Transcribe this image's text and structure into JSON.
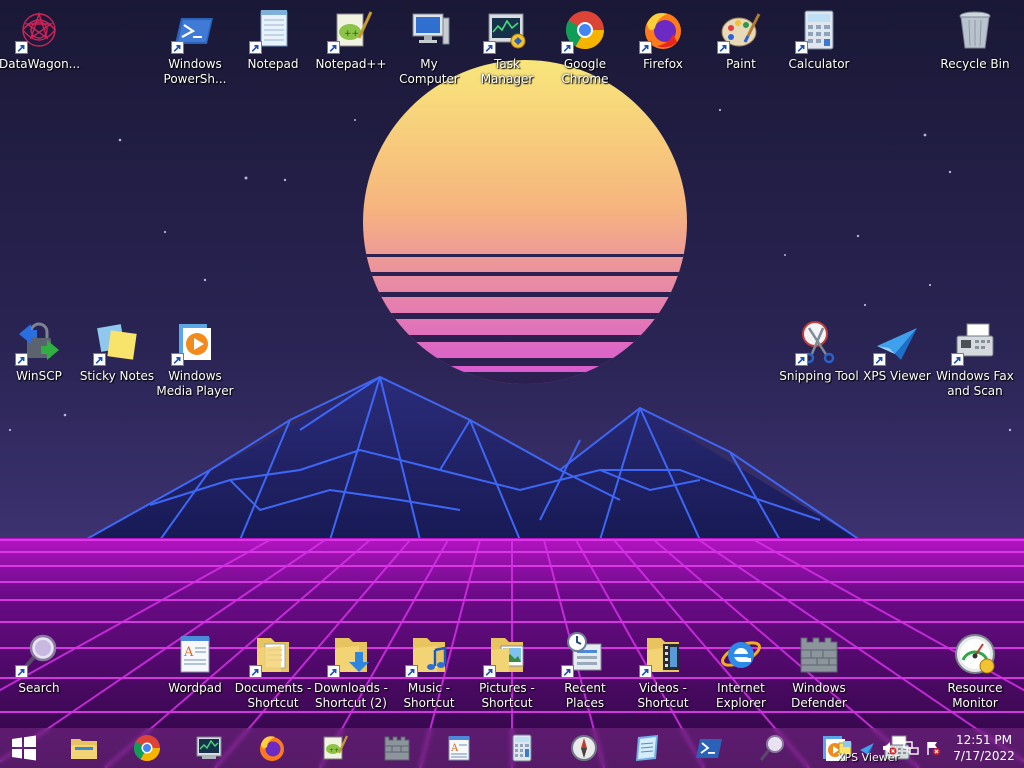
{
  "desktop": {
    "top_row": [
      {
        "name": "datawagon-icon",
        "label": "DataWagon...",
        "icon": "spiral-mandala"
      },
      {
        "name": "windows-powershell-icon",
        "label": "Windows\nPowerSh...",
        "icon": "powershell"
      },
      {
        "name": "notepad-icon",
        "label": "Notepad",
        "icon": "notepad"
      },
      {
        "name": "notepad-plus-plus-icon",
        "label": "Notepad++",
        "icon": "notepad-plus-plus"
      },
      {
        "name": "my-computer-icon",
        "label": "My Computer",
        "icon": "computer"
      },
      {
        "name": "task-manager-icon",
        "label": "Task Manager",
        "icon": "task-manager"
      },
      {
        "name": "google-chrome-icon",
        "label": "Google\nChrome",
        "icon": "chrome"
      },
      {
        "name": "firefox-icon",
        "label": "Firefox",
        "icon": "firefox"
      },
      {
        "name": "paint-icon",
        "label": "Paint",
        "icon": "paint-palette"
      },
      {
        "name": "calculator-icon",
        "label": "Calculator",
        "icon": "calculator"
      },
      {
        "name": "recycle-bin-icon",
        "label": "Recycle Bin",
        "icon": "recycle-bin"
      }
    ],
    "mid_left": [
      {
        "name": "winscp-icon",
        "label": "WinSCP",
        "icon": "winscp-lock"
      },
      {
        "name": "sticky-notes-icon",
        "label": "Sticky Notes",
        "icon": "sticky-notes"
      },
      {
        "name": "windows-media-player-icon",
        "label": "Windows\nMedia Player",
        "icon": "media-player"
      }
    ],
    "mid_right": [
      {
        "name": "snipping-tool-icon",
        "label": "Snipping Tool",
        "icon": "scissors"
      },
      {
        "name": "xps-viewer-icon",
        "label": "XPS Viewer",
        "icon": "paper-plane"
      },
      {
        "name": "windows-fax-and-scan-icon",
        "label": "Windows Fax\nand Scan",
        "icon": "fax-machine"
      }
    ],
    "bottom_row": [
      {
        "name": "search-icon",
        "label": "Search",
        "icon": "magnifier"
      },
      {
        "name": "wordpad-icon",
        "label": "Wordpad",
        "icon": "wordpad"
      },
      {
        "name": "documents-shortcut-icon",
        "label": "Documents -\nShortcut",
        "icon": "folder-documents"
      },
      {
        "name": "downloads-shortcut-icon",
        "label": "Downloads -\nShortcut (2)",
        "icon": "folder-downloads"
      },
      {
        "name": "music-shortcut-icon",
        "label": "Music -\nShortcut",
        "icon": "folder-music"
      },
      {
        "name": "pictures-shortcut-icon",
        "label": "Pictures -\nShortcut",
        "icon": "folder-pictures"
      },
      {
        "name": "recent-places-icon",
        "label": "Recent Places",
        "icon": "recent-places"
      },
      {
        "name": "videos-shortcut-icon",
        "label": "Videos -\nShortcut",
        "icon": "folder-videos"
      },
      {
        "name": "internet-explorer-icon",
        "label": "Internet\nExplorer",
        "icon": "internet-explorer"
      },
      {
        "name": "windows-defender-icon",
        "label": "Windows\nDefender",
        "icon": "castle-wall"
      },
      {
        "name": "resource-monitor-icon",
        "label": "Resource\nMonitor",
        "icon": "gauge"
      }
    ]
  },
  "taskbar": {
    "buttons": [
      {
        "name": "start-button",
        "icon": "windows-logo"
      },
      {
        "name": "taskbar-file-explorer",
        "icon": "file-explorer"
      },
      {
        "name": "taskbar-chrome",
        "icon": "chrome"
      },
      {
        "name": "taskbar-task-manager",
        "icon": "task-manager"
      },
      {
        "name": "taskbar-firefox",
        "icon": "firefox"
      },
      {
        "name": "taskbar-notepad-plus-plus",
        "icon": "notepad-plus-plus"
      },
      {
        "name": "taskbar-windows-defender",
        "icon": "castle-wall"
      },
      {
        "name": "taskbar-wordpad",
        "icon": "wordpad"
      },
      {
        "name": "taskbar-calculator",
        "icon": "calculator"
      },
      {
        "name": "taskbar-compass",
        "icon": "compass"
      },
      {
        "name": "taskbar-notes",
        "icon": "notebook"
      },
      {
        "name": "taskbar-powershell",
        "icon": "powershell"
      },
      {
        "name": "taskbar-search",
        "icon": "magnifier"
      },
      {
        "name": "taskbar-media-player",
        "icon": "media-player"
      },
      {
        "name": "taskbar-fax",
        "icon": "fax-machine"
      }
    ],
    "tray": {
      "overlay_label": "XPS Viewer",
      "time": "12:51 PM",
      "date": "7/17/2022"
    }
  },
  "colors": {
    "sun_top": "#f7e07a",
    "sun_bottom": "#d84fd0",
    "grid_magenta": "#e03ce8",
    "mountain_lines": "#3c6cff",
    "sky": "#211d47"
  }
}
